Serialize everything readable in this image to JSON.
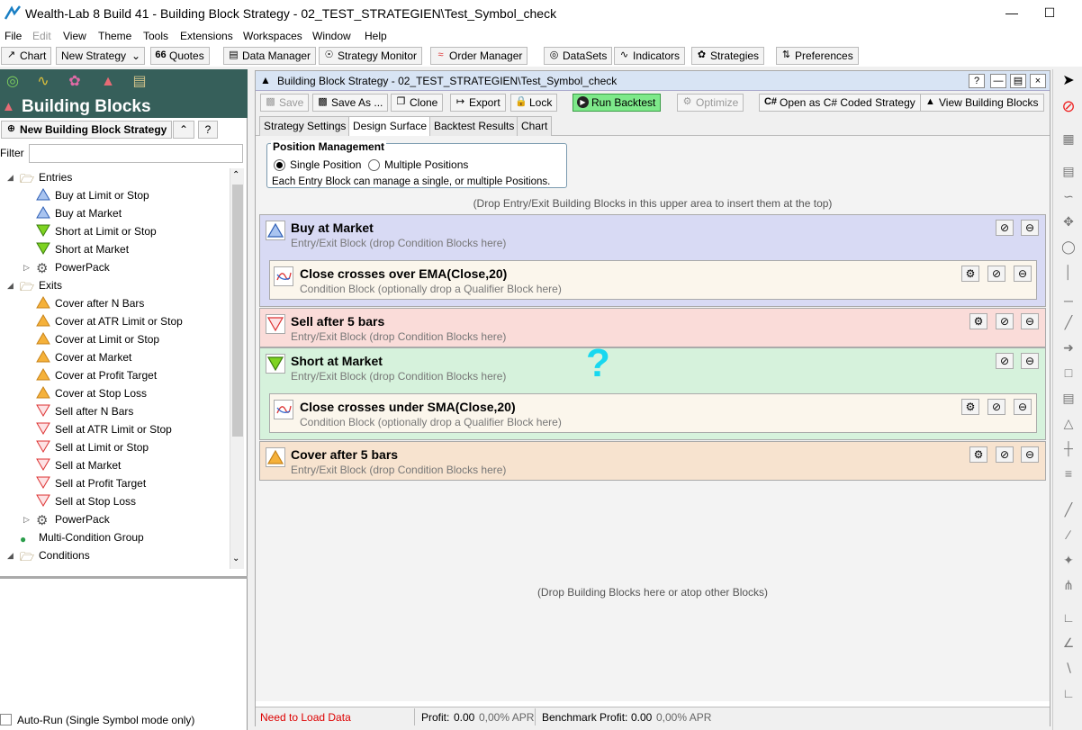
{
  "window": {
    "title": "Wealth-Lab 8 Build 41 - Building Block Strategy - 02_TEST_STRATEGIEN\\Test_Symbol_check"
  },
  "menu": [
    "File",
    "Edit",
    "View",
    "Theme",
    "Tools",
    "Extensions",
    "Workspaces",
    "Window",
    "Help"
  ],
  "toolbar": {
    "chart": "Chart",
    "new_strategy": "New Strategy",
    "quotes": "Quotes",
    "data_manager": "Data Manager",
    "strategy_monitor": "Strategy Monitor",
    "order_manager": "Order Manager",
    "datasets": "DataSets",
    "indicators": "Indicators",
    "strategies": "Strategies",
    "preferences": "Preferences"
  },
  "left_panel": {
    "title": "Building Blocks",
    "new_button": "New Building Block Strategy",
    "filter_label": "Filter",
    "filter_value": "",
    "tree": [
      {
        "label": "Entries",
        "kind": "folder",
        "level": 0
      },
      {
        "label": "Buy at Limit or Stop",
        "kind": "buy",
        "level": 1
      },
      {
        "label": "Buy at Market",
        "kind": "buy",
        "level": 1
      },
      {
        "label": "Short at Limit or Stop",
        "kind": "short",
        "level": 1
      },
      {
        "label": "Short at Market",
        "kind": "short",
        "level": 1
      },
      {
        "label": "PowerPack",
        "kind": "gear",
        "level": 1
      },
      {
        "label": "Exits",
        "kind": "folder",
        "level": 0
      },
      {
        "label": "Cover after N Bars",
        "kind": "cover",
        "level": 1
      },
      {
        "label": "Cover at ATR Limit or Stop",
        "kind": "cover",
        "level": 1
      },
      {
        "label": "Cover at Limit or Stop",
        "kind": "cover",
        "level": 1
      },
      {
        "label": "Cover at Market",
        "kind": "cover",
        "level": 1
      },
      {
        "label": "Cover at Profit Target",
        "kind": "cover",
        "level": 1
      },
      {
        "label": "Cover at Stop Loss",
        "kind": "cover",
        "level": 1
      },
      {
        "label": "Sell after N Bars",
        "kind": "sell",
        "level": 1
      },
      {
        "label": "Sell at ATR Limit or Stop",
        "kind": "sell",
        "level": 1
      },
      {
        "label": "Sell at Limit or Stop",
        "kind": "sell",
        "level": 1
      },
      {
        "label": "Sell at Market",
        "kind": "sell",
        "level": 1
      },
      {
        "label": "Sell at Profit Target",
        "kind": "sell",
        "level": 1
      },
      {
        "label": "Sell at Stop Loss",
        "kind": "sell",
        "level": 1
      },
      {
        "label": "PowerPack",
        "kind": "gear",
        "level": 1
      },
      {
        "label": "Multi-Condition Group",
        "kind": "group",
        "level": 0
      },
      {
        "label": "Conditions",
        "kind": "folder",
        "level": 0
      }
    ],
    "auto_run": "Auto-Run (Single Symbol mode only)"
  },
  "doc": {
    "title": "Building Block Strategy - 02_TEST_STRATEGIEN\\Test_Symbol_check",
    "toolbar": {
      "save": "Save",
      "save_as": "Save As ...",
      "clone": "Clone",
      "export": "Export",
      "lock": "Lock",
      "run_backtest": "Run Backtest",
      "optimize": "Optimize",
      "open_csharp": "Open as C# Coded Strategy",
      "view_blocks": "View Building Blocks"
    },
    "tabs": [
      "Strategy Settings",
      "Design Surface",
      "Backtest Results",
      "Chart"
    ],
    "active_tab": "Design Surface",
    "position_management": {
      "title": "Position Management",
      "single": "Single Position",
      "multiple": "Multiple Positions",
      "selected": "single",
      "note": "Each Entry Block can manage a single, or multiple Positions."
    },
    "top_hint": "(Drop Entry/Exit Building Blocks in this upper area to insert them at the top)",
    "bottom_hint": "(Drop Building Blocks here or atop other Blocks)",
    "blocks": [
      {
        "title": "Buy at Market",
        "subtitle": "Entry/Exit Block (drop Condition Blocks here)",
        "kind": "buy",
        "color": "#d8daf4",
        "condition": {
          "title": "Close crosses over EMA(Close,20)",
          "subtitle": "Condition Block (optionally drop a Qualifier Block here)"
        }
      },
      {
        "title": "Sell after 5 bars",
        "subtitle": "Entry/Exit Block (drop Condition Blocks here)",
        "kind": "sell",
        "color": "#fadcd9"
      },
      {
        "title": "Short at Market",
        "subtitle": "Entry/Exit Block (drop Condition Blocks here)",
        "kind": "short",
        "color": "#d6f2dc",
        "condition": {
          "title": "Close crosses under SMA(Close,20)",
          "subtitle": "Condition Block (optionally drop a Qualifier Block here)"
        }
      },
      {
        "title": "Cover after 5 bars",
        "subtitle": "Entry/Exit Block (drop Condition Blocks here)",
        "kind": "cover",
        "color": "#f7e3cf"
      }
    ],
    "annotation": "?",
    "status": {
      "message": "Need to Load Data",
      "profit_label": "Profit:",
      "profit": "0.00",
      "profit_apr": "0,00% APR",
      "bench_label": "Benchmark Profit:",
      "bench": "0.00",
      "bench_apr": "0,00% APR"
    }
  }
}
